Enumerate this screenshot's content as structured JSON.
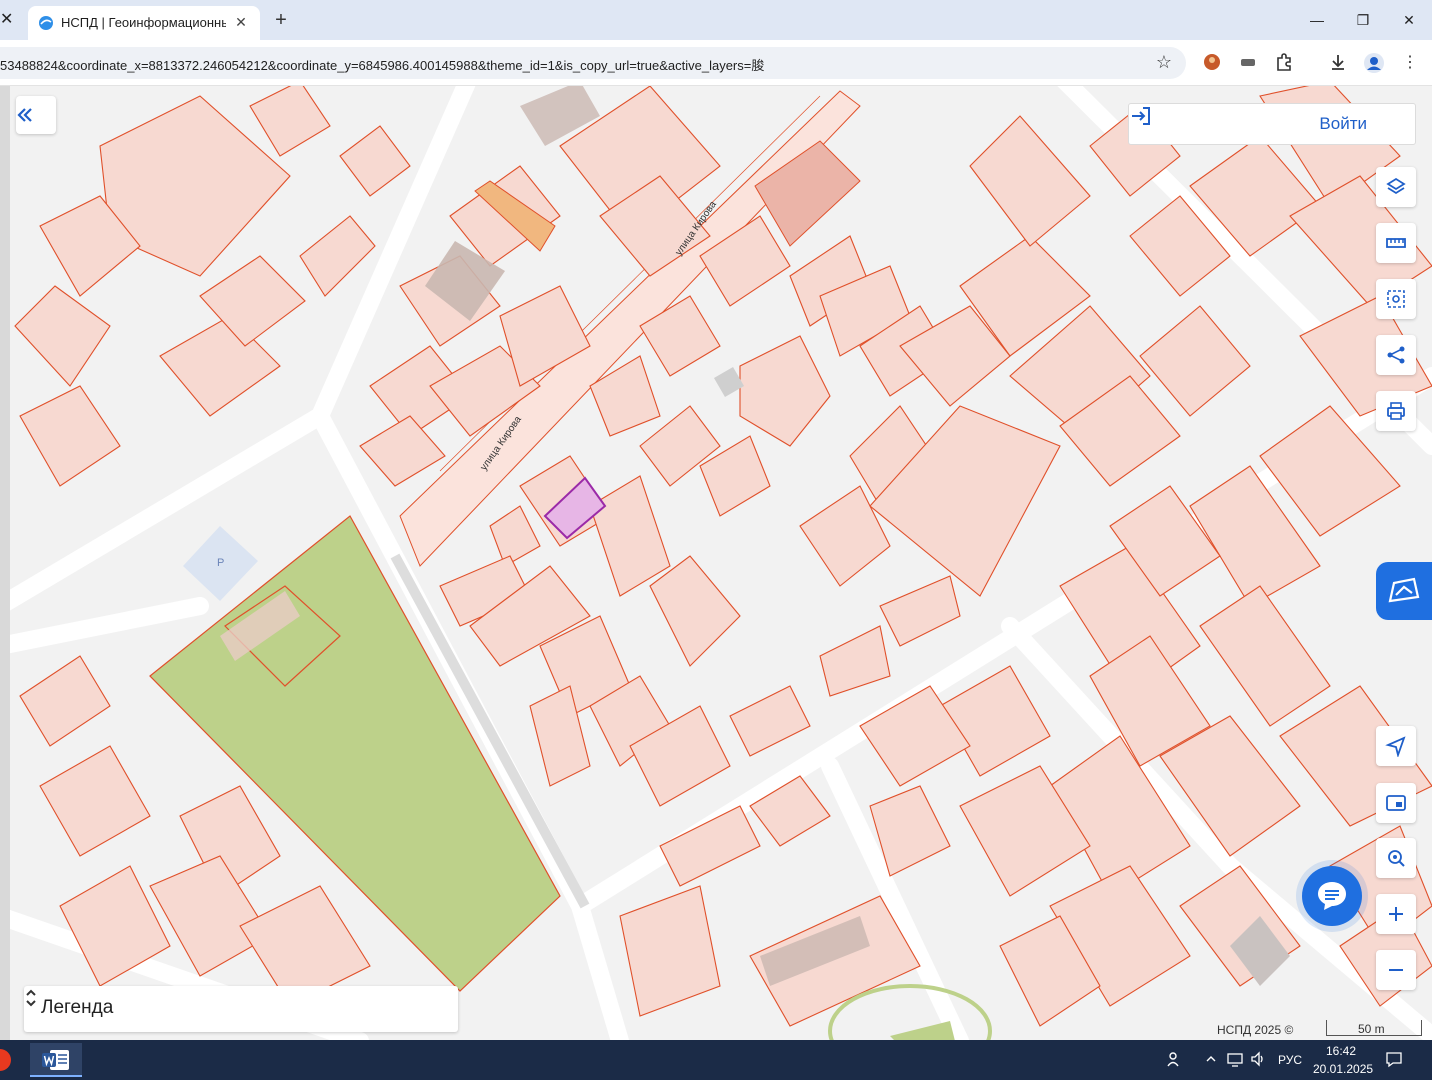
{
  "browser": {
    "tab_title": "НСПД | Геоинформационный",
    "address_url": "53488824&coordinate_x=8813372.246054212&coordinate_y=6845986.400145988&theme_id=1&is_copy_url=true&active_layers=朘"
  },
  "map": {
    "login_label": "Войти",
    "parking_label": "P",
    "street_label_1": "улица Кирова",
    "street_label_2": "улица Кирова",
    "legend_label": "Легенда",
    "copyright": "НСПД 2025 ©",
    "scale_label": "50 m"
  },
  "icons": {
    "collapse": "double-chevron-left-icon",
    "login": "login-icon",
    "layers": "layers-icon",
    "ruler": "ruler-icon",
    "select_area": "select-area-icon",
    "share": "share-icon",
    "print": "print-icon",
    "navigate": "navigation-arrow-icon",
    "minimap": "minimap-icon",
    "locate": "locate-icon",
    "zoom_in": "plus-icon",
    "zoom_out": "minus-icon",
    "chat": "chat-icon"
  },
  "colors": {
    "parcel_stroke": "#e0502a",
    "parcel_fill": "#f7d9d1",
    "green_area": "#bdd18a",
    "selected_parcel": "#9b2aa8",
    "accent": "#1f5fc9"
  },
  "taskbar": {
    "language": "РУС",
    "time": "16:42",
    "date": "20.01.2025"
  }
}
